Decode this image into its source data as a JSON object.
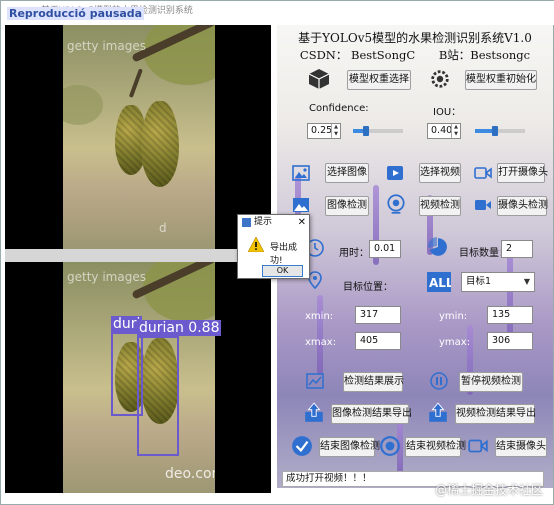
{
  "window": {
    "title_badge": "Reproducció pausada",
    "title_faint": "基于YOLOv5模型的水果检测识别系统"
  },
  "panel": {
    "title": "基于YOLOv5模型的水果检测识别系统V1.0",
    "csdn": "CSDN：  BestSongC",
    "bili": "B站：Bestsongc"
  },
  "model": {
    "select_label": "模型权重选择",
    "init_label": "模型权重初始化"
  },
  "thresholds": {
    "confidence_label": "Confidence:",
    "iou_label": "IOU：",
    "confidence_value": "0.25",
    "iou_value": "0.40",
    "confidence_slider": 0.25,
    "iou_slider": 0.4
  },
  "actions": {
    "select_image": "选择图像",
    "select_video": "选择视频",
    "open_camera": "打开摄像头",
    "image_detect": "图像检测",
    "video_detect": "视频检测",
    "camera_detect": "摄像头检测"
  },
  "stats": {
    "time_label": "用时：",
    "time_value": "0.01",
    "count_label": "目标数量：",
    "count_value": "2",
    "position_label": "目标位置：",
    "target_select": "目标1",
    "xmin_label": "xmin:",
    "xmin_value": "317",
    "ymin_label": "ymin:",
    "ymin_value": "135",
    "xmax_label": "xmax:",
    "xmax_value": "405",
    "ymax_label": "ymax:",
    "ymax_value": "306"
  },
  "controls": {
    "show_results": "检测结果展示",
    "pause_video": "暂停视频检测",
    "export_image": "图像检测结果导出",
    "export_video": "视频检测结果导出",
    "end_image": "结束图像检测",
    "end_video": "结束视频检测",
    "end_camera": "结束摄像头"
  },
  "status_bar": "成功打开视频！！！",
  "site_watermark": "@稀土掘金技术社区",
  "video": {
    "top_watermark": "getty images",
    "bottom_watermark": "deo.com",
    "detections": [
      {
        "label": "duri"
      },
      {
        "label": "durian  0.88"
      }
    ]
  },
  "dialog": {
    "title": "提示",
    "message": "导出成功!",
    "ok": "OK"
  },
  "colors": {
    "detection_box": "#6a5acd",
    "accent_blue": "#2f6fd0"
  }
}
